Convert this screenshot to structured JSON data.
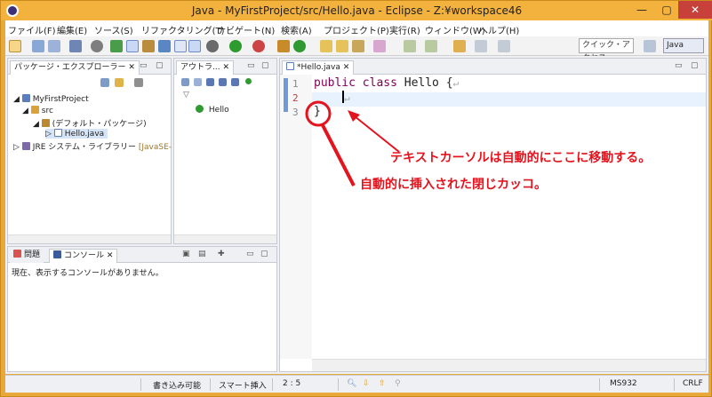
{
  "window": {
    "title": "Java - MyFirstProject/src/Hello.java - Eclipse - Z:¥workspace46"
  },
  "menu": [
    "ファイル(F)",
    "編集(E)",
    "ソース(S)",
    "リファクタリング(T)",
    "ナビゲート(N)",
    "検索(A)",
    "プロジェクト(P)",
    "実行(R)",
    "ウィンドウ(W)",
    "ヘルプ(H)"
  ],
  "toolbar": {
    "quick_access": "クイック・アクセス",
    "perspective": "Java"
  },
  "package_explorer": {
    "tab": "パッケージ・エクスプローラー",
    "tree": {
      "project": "MyFirstProject",
      "src": "src",
      "package": "(デフォルト・パッケージ)",
      "file": "Hello.java",
      "jre_prefix": "JRE システム・ライブラリー",
      "jre_suffix": "[JavaSE-"
    }
  },
  "outline": {
    "tab": "アウトラ...",
    "class": "Hello"
  },
  "bottom_view": {
    "tabs": {
      "problems": "問題",
      "console": "コンソール"
    },
    "message": "現在、表示するコンソールがありません。"
  },
  "editor": {
    "tab": "*Hello.java",
    "line_numbers": [
      "1",
      "2",
      "3"
    ],
    "lines": {
      "l1_kw": "public class",
      "l1_rest": " Hello {",
      "l3": "}"
    },
    "pilcrow": "↵"
  },
  "annotations": {
    "cursor_note": "テキストカーソルは自動的にここに移動する。",
    "brace_note": "自動的に挿入された閉じカッコ。",
    "color": "#e3141e"
  },
  "status": {
    "writable": "書き込み可能",
    "insert_mode": "スマート挿入",
    "position": "2 : 5",
    "encoding": "MS932",
    "line_ending": "CRLF"
  }
}
